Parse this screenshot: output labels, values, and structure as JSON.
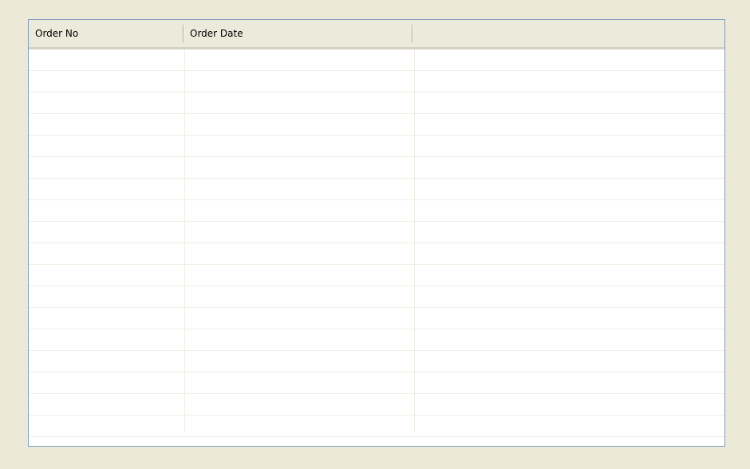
{
  "list": {
    "columns": [
      {
        "label": "Order No"
      },
      {
        "label": "Order Date"
      },
      {
        "label": ""
      }
    ],
    "rows": []
  }
}
